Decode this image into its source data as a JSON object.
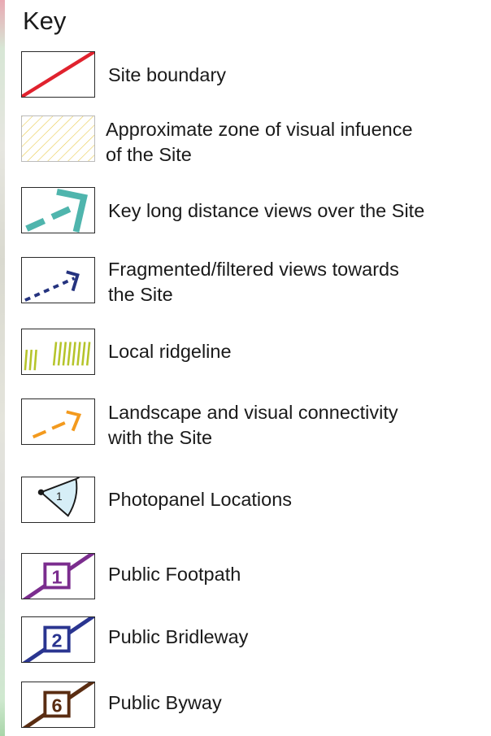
{
  "title": "Key",
  "items": [
    {
      "label_lines": [
        "Site boundary"
      ],
      "icon": "site-boundary-icon",
      "color": "#e0222e"
    },
    {
      "label_lines": [
        "Approximate zone of visual infuence",
        "of the Site"
      ],
      "icon": "visual-influence-hatch-icon",
      "color": "#e8c94a"
    },
    {
      "label_lines": [
        "Key long distance views over the Site"
      ],
      "icon": "long-distance-view-arrow-icon",
      "color": "#4fb5ad"
    },
    {
      "label_lines": [
        "Fragmented/filtered views towards",
        "the Site"
      ],
      "icon": "filtered-view-arrow-icon",
      "color": "#25337f"
    },
    {
      "label_lines": [
        "Local ridgeline"
      ],
      "icon": "ridgeline-icon",
      "color": "#b5c42a"
    },
    {
      "label_lines": [
        "Landscape and visual connectivity",
        "with the Site"
      ],
      "icon": "connectivity-arrow-icon",
      "color": "#f39a1e"
    },
    {
      "label_lines": [
        "Photopanel Locations"
      ],
      "icon": "photopanel-icon",
      "color": "#d6eef7",
      "badge": "1"
    },
    {
      "label_lines": [
        "Public Footpath"
      ],
      "icon": "public-footpath-icon",
      "color": "#7b2d8e",
      "badge": "1"
    },
    {
      "label_lines": [
        "Public Bridleway"
      ],
      "icon": "public-bridleway-icon",
      "color": "#2a3590",
      "badge": "2"
    },
    {
      "label_lines": [
        "Public Byway"
      ],
      "icon": "public-byway-icon",
      "color": "#5a2d12",
      "badge": "6"
    }
  ]
}
